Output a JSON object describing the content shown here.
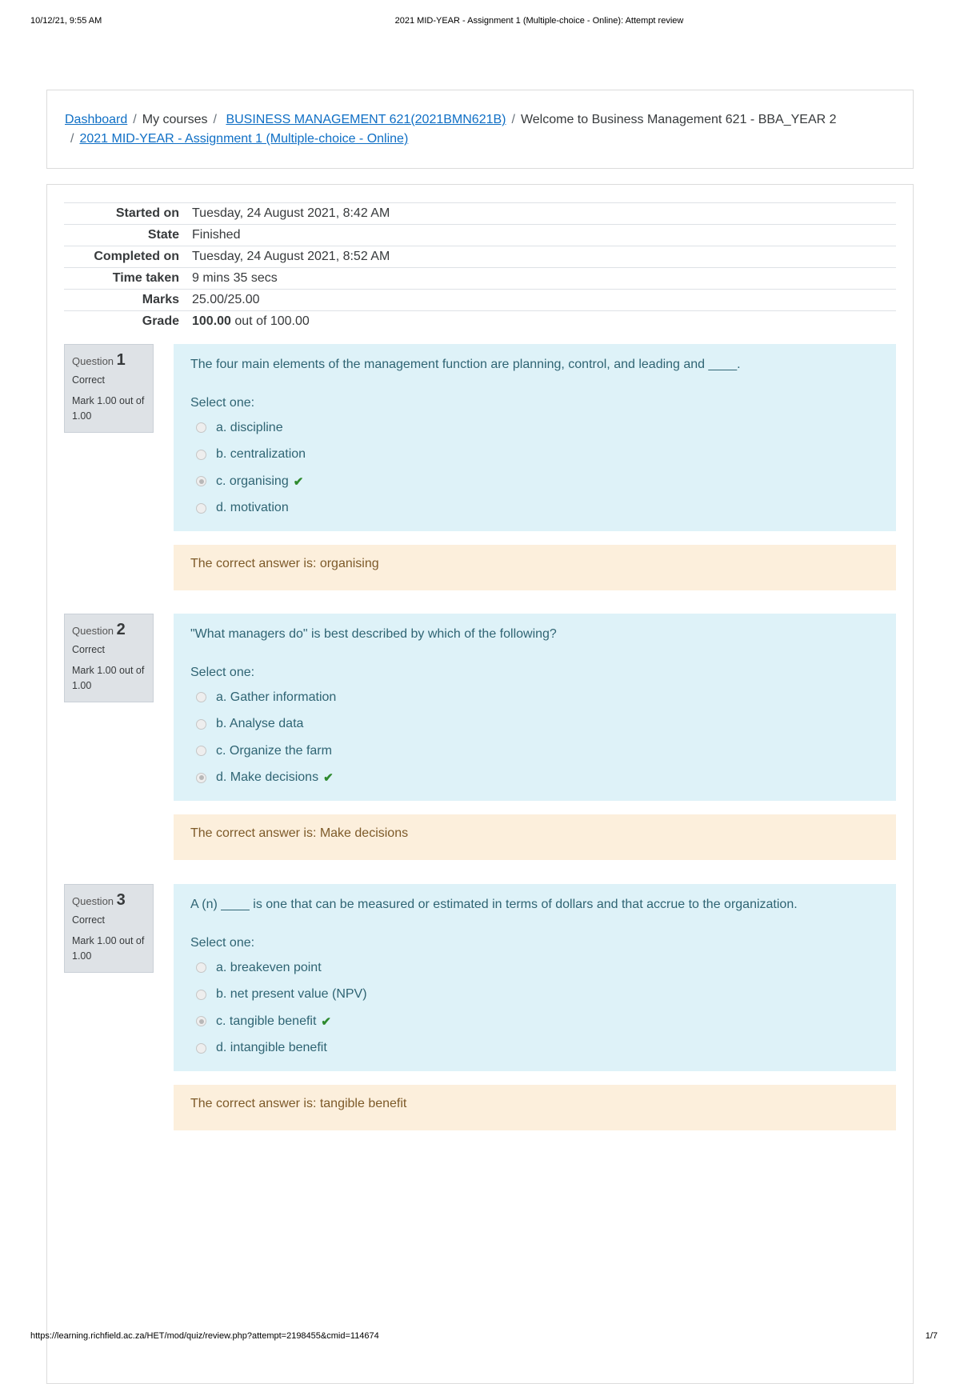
{
  "print_header": {
    "datetime": "10/12/21, 9:55 AM",
    "title": "2021 MID-YEAR - Assignment 1 (Multiple-choice - Online): Attempt review"
  },
  "print_footer": {
    "url": "https://learning.richfield.ac.za/HET/mod/quiz/review.php?attempt=2198455&cmid=114674",
    "page": "1/7"
  },
  "breadcrumb": {
    "items": [
      {
        "label": "Dashboard",
        "link": true
      },
      {
        "label": "My courses",
        "link": false
      },
      {
        "label": "BUSINESS MANAGEMENT 621(2021BMN621B)",
        "link": true
      },
      {
        "label": "Welcome to Business Management 621 - BBA_YEAR 2",
        "link": false
      },
      {
        "label": "2021 MID-YEAR - Assignment 1 (Multiple-choice - Online)",
        "link": true
      }
    ],
    "separator": "/"
  },
  "summary": {
    "rows": [
      {
        "label": "Started on",
        "value": "Tuesday, 24 August 2021, 8:42 AM"
      },
      {
        "label": "State",
        "value": "Finished"
      },
      {
        "label": "Completed on",
        "value": "Tuesday, 24 August 2021, 8:52 AM"
      },
      {
        "label": "Time taken",
        "value": "9 mins 35 secs"
      },
      {
        "label": "Marks",
        "value": "25.00/25.00"
      },
      {
        "label": "Grade",
        "value_bold": "100.00",
        "value_rest": " out of 100.00"
      }
    ]
  },
  "questions": [
    {
      "label": "Question",
      "number": "1",
      "state": "Correct",
      "mark": "Mark 1.00 out of 1.00",
      "text": "The four main elements of the management function are planning, control, and leading and ____.",
      "prompt": "Select one:",
      "options": [
        {
          "label": "a. discipline",
          "selected": false,
          "correct": false
        },
        {
          "label": "b. centralization",
          "selected": false,
          "correct": false
        },
        {
          "label": "c. organising",
          "selected": true,
          "correct": true
        },
        {
          "label": "d. motivation",
          "selected": false,
          "correct": false
        }
      ],
      "feedback": "The correct answer is: organising"
    },
    {
      "label": "Question",
      "number": "2",
      "state": "Correct",
      "mark": "Mark 1.00 out of 1.00",
      "text": "\"What managers do\" is best described by which of the following?",
      "prompt": "Select one:",
      "options": [
        {
          "label": "a. Gather information",
          "selected": false,
          "correct": false
        },
        {
          "label": "b. Analyse data",
          "selected": false,
          "correct": false
        },
        {
          "label": "c. Organize the farm",
          "selected": false,
          "correct": false
        },
        {
          "label": "d. Make decisions",
          "selected": true,
          "correct": true
        }
      ],
      "feedback": "The correct answer is: Make decisions"
    },
    {
      "label": "Question",
      "number": "3",
      "state": "Correct",
      "mark": "Mark 1.00 out of 1.00",
      "text": "A (n) ____ is one that can be measured or estimated in terms of dollars and that accrue to the organization.",
      "prompt": "Select one:",
      "options": [
        {
          "label": "a. breakeven point",
          "selected": false,
          "correct": false
        },
        {
          "label": "b. net present value (NPV)",
          "selected": false,
          "correct": false
        },
        {
          "label": "c. tangible benefit",
          "selected": true,
          "correct": true
        },
        {
          "label": "d. intangible benefit",
          "selected": false,
          "correct": false
        }
      ],
      "feedback": "The correct answer is: tangible benefit"
    }
  ],
  "icons": {
    "correct": "check-mark-icon",
    "radio": "radio-button-icon"
  },
  "colors": {
    "link": "#0f6fc5",
    "question_bg": "#def2f8",
    "question_text": "#2f6473",
    "feedback_bg": "#fcefdc",
    "feedback_text": "#7d5a29",
    "info_bg": "#dee2e6",
    "correct_check": "#2e8a2e"
  }
}
